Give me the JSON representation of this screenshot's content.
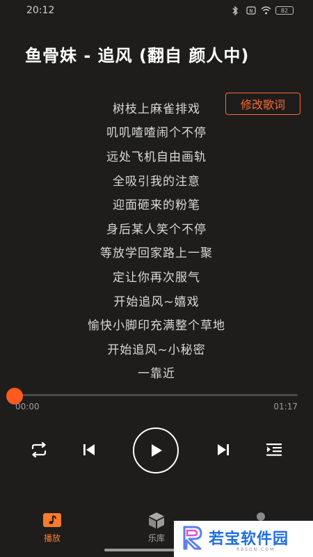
{
  "status_bar": {
    "time": "20:12",
    "battery": "82"
  },
  "song": {
    "title": "鱼骨妹 - 追风 (翻自 颜人中)"
  },
  "actions": {
    "edit_lyrics_label": "修改歌词"
  },
  "lyrics": [
    "树枝上麻雀排戏",
    "叽叽喳喳闹个不停",
    "远处飞机自由画轨",
    "全吸引我的注意",
    "迎面砸来的粉笔",
    "身后某人笑个不停",
    "等放学回家路上一聚",
    "定让你再次服气",
    "开始追风~嬉戏",
    "愉快小脚印充满整个草地",
    "开始追风~小秘密",
    "一靠近"
  ],
  "player": {
    "current_time": "00:00",
    "total_time": "01:17",
    "progress": 0.0
  },
  "nav": {
    "play_label": "播放",
    "library_label": "乐库",
    "profile_label": ""
  },
  "watermark": {
    "main": "若宝软件园",
    "sub": "RBSGN.COM"
  },
  "colors": {
    "accent": "#ff6a33",
    "background": "#1e1d1c"
  }
}
